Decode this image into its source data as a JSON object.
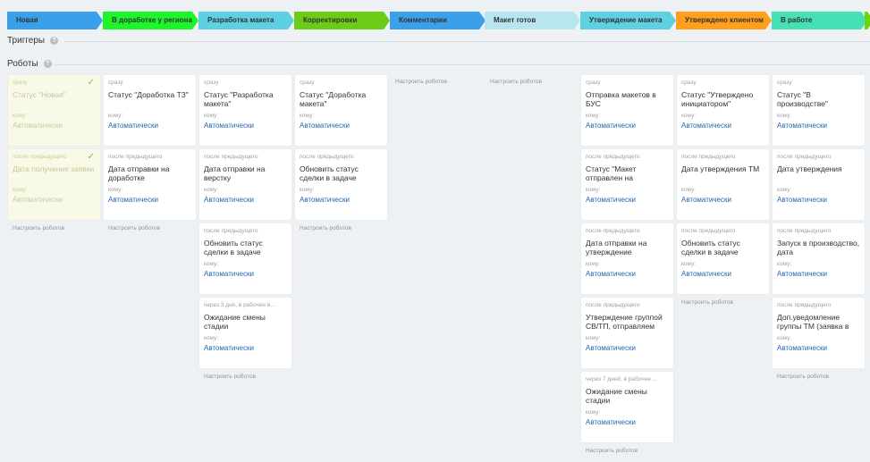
{
  "stages": [
    {
      "label": "Новая",
      "color": "#3aa0ea"
    },
    {
      "label": "В доработке у региона",
      "color": "#1cf52a"
    },
    {
      "label": "Разработка макета",
      "color": "#5ed0e2"
    },
    {
      "label": "Корректировки",
      "color": "#6ccc18"
    },
    {
      "label": "Комментарии",
      "color": "#3aa0ea"
    },
    {
      "label": "Макет готов",
      "color": "#b8e6f0"
    },
    {
      "label": "Утверждение макета",
      "color": "#5ed0e2"
    },
    {
      "label": "Утверждено клиентом",
      "color": "#ff9f1c"
    },
    {
      "label": "В работе",
      "color": "#45e0b4"
    },
    {
      "label": "",
      "color": "#6ed40c"
    }
  ],
  "triggers": {
    "label": "Триггеры",
    "help": "?"
  },
  "robots": {
    "label": "Роботы",
    "help": "?"
  },
  "who_label": "кому:",
  "auto_label": "Автоматически",
  "config_label": "Настроить роботов",
  "check_glyph": "✓",
  "columns": [
    {
      "cards": [
        {
          "cond": "сразу",
          "title": "Статус \"Новая\"",
          "done": true
        },
        {
          "cond": "после предыдущего",
          "title": "Дата получения заявки",
          "done": true
        }
      ]
    },
    {
      "cards": [
        {
          "cond": "сразу",
          "title": "Статус \"Доработка ТЗ\""
        },
        {
          "cond": "после предыдущего",
          "title": "Дата отправки на доработке"
        }
      ]
    },
    {
      "cards": [
        {
          "cond": "сразу",
          "title": "Статус \"Разработка макета\""
        },
        {
          "cond": "после предыдущего",
          "title": "Дата отправки на верстку"
        },
        {
          "cond": "после предыдущего",
          "title": "Обновить статус сделки в задаче"
        },
        {
          "cond": "через 3 дня, в рабочее в...",
          "title": "Ожидание смены стадии"
        }
      ]
    },
    {
      "cards": [
        {
          "cond": "сразу",
          "title": "Статус \"Доработка макета\""
        },
        {
          "cond": "после предыдущего",
          "title": "Обновить статус сделки в задаче"
        }
      ]
    },
    {
      "cards": []
    },
    {
      "cards": []
    },
    {
      "cards": [
        {
          "cond": "сразу",
          "title": "Отправка макетов в БУС"
        },
        {
          "cond": "после предыдущего",
          "title": "Статус \"Макет отправлен на"
        },
        {
          "cond": "после предыдущего",
          "title": "Дата отправки на утверждение"
        },
        {
          "cond": "после предыдущего",
          "title": "Утверждение группой СВ/ТП, отправляем"
        },
        {
          "cond": "через 7 дней, в рабочее ...",
          "title": "Ожидание смены стадии"
        }
      ]
    },
    {
      "cards": [
        {
          "cond": "сразу",
          "title": "Статус \"Утверждено инициатором\""
        },
        {
          "cond": "после предыдущего",
          "title": "Дата утверждения ТМ"
        },
        {
          "cond": "после предыдущего",
          "title": "Обновить статус сделки в задаче"
        }
      ]
    },
    {
      "cards": [
        {
          "cond": "сразу",
          "title": "Статус \"В производстве\""
        },
        {
          "cond": "после предыдущего",
          "title": "Дата утверждения"
        },
        {
          "cond": "после предыдущего",
          "title": "Запуск в производство, дата"
        },
        {
          "cond": "после предыдущего",
          "title": "Доп.уведомление группы ТМ (заявка в"
        }
      ]
    }
  ]
}
